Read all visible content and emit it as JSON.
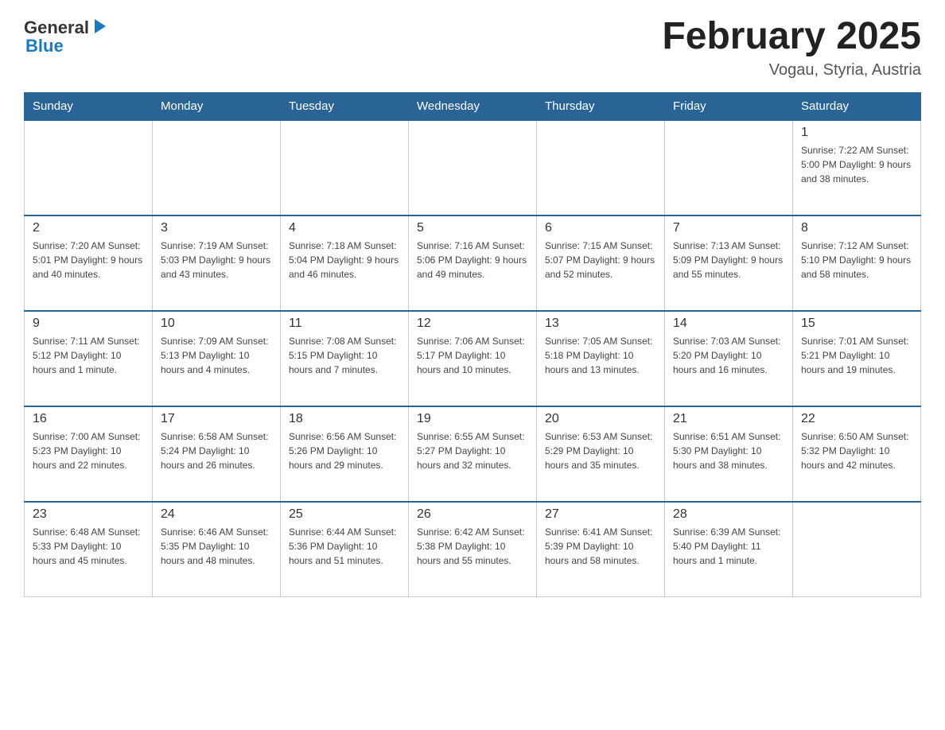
{
  "logo": {
    "text_general": "General",
    "text_blue": "Blue",
    "arrow": "▶"
  },
  "header": {
    "title": "February 2025",
    "subtitle": "Vogau, Styria, Austria"
  },
  "days_of_week": [
    "Sunday",
    "Monday",
    "Tuesday",
    "Wednesday",
    "Thursday",
    "Friday",
    "Saturday"
  ],
  "weeks": [
    [
      {
        "day": "",
        "info": ""
      },
      {
        "day": "",
        "info": ""
      },
      {
        "day": "",
        "info": ""
      },
      {
        "day": "",
        "info": ""
      },
      {
        "day": "",
        "info": ""
      },
      {
        "day": "",
        "info": ""
      },
      {
        "day": "1",
        "info": "Sunrise: 7:22 AM\nSunset: 5:00 PM\nDaylight: 9 hours and 38 minutes."
      }
    ],
    [
      {
        "day": "2",
        "info": "Sunrise: 7:20 AM\nSunset: 5:01 PM\nDaylight: 9 hours and 40 minutes."
      },
      {
        "day": "3",
        "info": "Sunrise: 7:19 AM\nSunset: 5:03 PM\nDaylight: 9 hours and 43 minutes."
      },
      {
        "day": "4",
        "info": "Sunrise: 7:18 AM\nSunset: 5:04 PM\nDaylight: 9 hours and 46 minutes."
      },
      {
        "day": "5",
        "info": "Sunrise: 7:16 AM\nSunset: 5:06 PM\nDaylight: 9 hours and 49 minutes."
      },
      {
        "day": "6",
        "info": "Sunrise: 7:15 AM\nSunset: 5:07 PM\nDaylight: 9 hours and 52 minutes."
      },
      {
        "day": "7",
        "info": "Sunrise: 7:13 AM\nSunset: 5:09 PM\nDaylight: 9 hours and 55 minutes."
      },
      {
        "day": "8",
        "info": "Sunrise: 7:12 AM\nSunset: 5:10 PM\nDaylight: 9 hours and 58 minutes."
      }
    ],
    [
      {
        "day": "9",
        "info": "Sunrise: 7:11 AM\nSunset: 5:12 PM\nDaylight: 10 hours and 1 minute."
      },
      {
        "day": "10",
        "info": "Sunrise: 7:09 AM\nSunset: 5:13 PM\nDaylight: 10 hours and 4 minutes."
      },
      {
        "day": "11",
        "info": "Sunrise: 7:08 AM\nSunset: 5:15 PM\nDaylight: 10 hours and 7 minutes."
      },
      {
        "day": "12",
        "info": "Sunrise: 7:06 AM\nSunset: 5:17 PM\nDaylight: 10 hours and 10 minutes."
      },
      {
        "day": "13",
        "info": "Sunrise: 7:05 AM\nSunset: 5:18 PM\nDaylight: 10 hours and 13 minutes."
      },
      {
        "day": "14",
        "info": "Sunrise: 7:03 AM\nSunset: 5:20 PM\nDaylight: 10 hours and 16 minutes."
      },
      {
        "day": "15",
        "info": "Sunrise: 7:01 AM\nSunset: 5:21 PM\nDaylight: 10 hours and 19 minutes."
      }
    ],
    [
      {
        "day": "16",
        "info": "Sunrise: 7:00 AM\nSunset: 5:23 PM\nDaylight: 10 hours and 22 minutes."
      },
      {
        "day": "17",
        "info": "Sunrise: 6:58 AM\nSunset: 5:24 PM\nDaylight: 10 hours and 26 minutes."
      },
      {
        "day": "18",
        "info": "Sunrise: 6:56 AM\nSunset: 5:26 PM\nDaylight: 10 hours and 29 minutes."
      },
      {
        "day": "19",
        "info": "Sunrise: 6:55 AM\nSunset: 5:27 PM\nDaylight: 10 hours and 32 minutes."
      },
      {
        "day": "20",
        "info": "Sunrise: 6:53 AM\nSunset: 5:29 PM\nDaylight: 10 hours and 35 minutes."
      },
      {
        "day": "21",
        "info": "Sunrise: 6:51 AM\nSunset: 5:30 PM\nDaylight: 10 hours and 38 minutes."
      },
      {
        "day": "22",
        "info": "Sunrise: 6:50 AM\nSunset: 5:32 PM\nDaylight: 10 hours and 42 minutes."
      }
    ],
    [
      {
        "day": "23",
        "info": "Sunrise: 6:48 AM\nSunset: 5:33 PM\nDaylight: 10 hours and 45 minutes."
      },
      {
        "day": "24",
        "info": "Sunrise: 6:46 AM\nSunset: 5:35 PM\nDaylight: 10 hours and 48 minutes."
      },
      {
        "day": "25",
        "info": "Sunrise: 6:44 AM\nSunset: 5:36 PM\nDaylight: 10 hours and 51 minutes."
      },
      {
        "day": "26",
        "info": "Sunrise: 6:42 AM\nSunset: 5:38 PM\nDaylight: 10 hours and 55 minutes."
      },
      {
        "day": "27",
        "info": "Sunrise: 6:41 AM\nSunset: 5:39 PM\nDaylight: 10 hours and 58 minutes."
      },
      {
        "day": "28",
        "info": "Sunrise: 6:39 AM\nSunset: 5:40 PM\nDaylight: 11 hours and 1 minute."
      },
      {
        "day": "",
        "info": ""
      }
    ]
  ]
}
